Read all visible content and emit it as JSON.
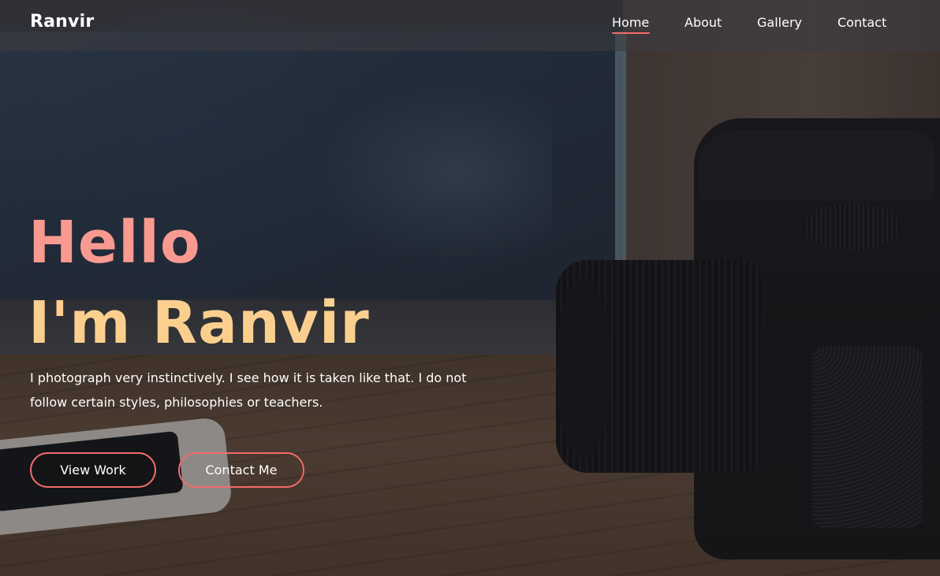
{
  "navbar": {
    "logo": "Ranvir",
    "links": [
      {
        "label": "Home",
        "active": true
      },
      {
        "label": "About",
        "active": false
      },
      {
        "label": "Gallery",
        "active": false
      },
      {
        "label": "Contact",
        "active": false
      }
    ]
  },
  "hero": {
    "greeting": "Hello",
    "name_line": "I'm Ranvir",
    "description": "I photograph very instinctively. I see how it is taken like that. I do not follow certain styles, philosophies or teachers.",
    "buttons": {
      "primary": "View Work",
      "secondary": "Contact Me"
    }
  },
  "colors": {
    "accent": "#f26b6b",
    "greeting": "#f99a90",
    "name": "#fccf8f",
    "navbar_bg": "rgba(60,60,66,0.55)"
  }
}
